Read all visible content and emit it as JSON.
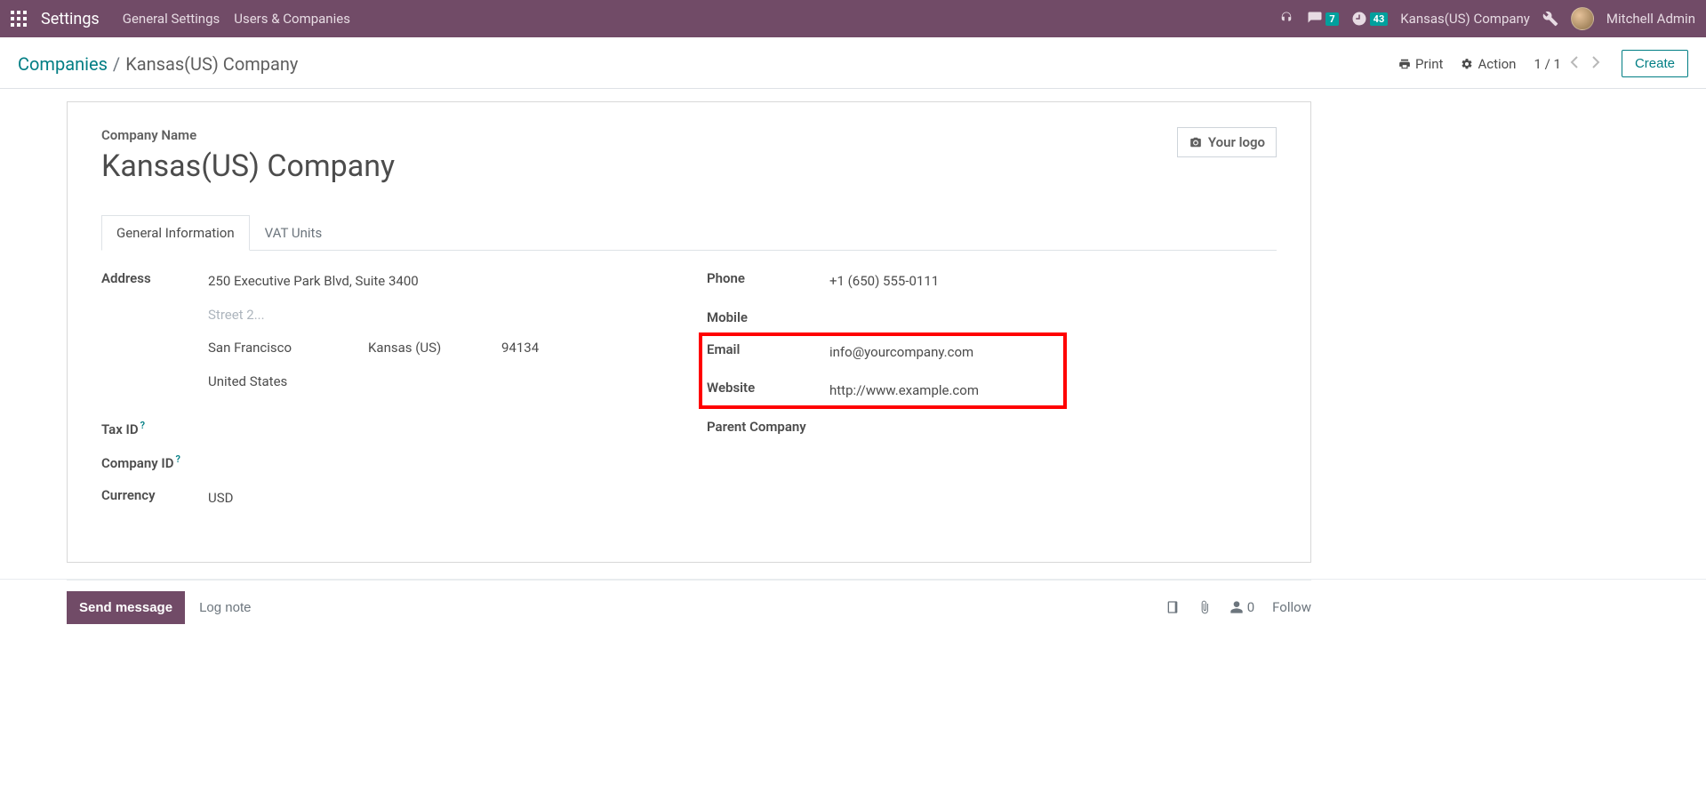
{
  "navbar": {
    "brand": "Settings",
    "links": [
      "General Settings",
      "Users & Companies"
    ],
    "messages_badge": "7",
    "activities_badge": "43",
    "company": "Kansas(US) Company",
    "user": "Mitchell Admin"
  },
  "breadcrumb": {
    "root": "Companies",
    "current": "Kansas(US) Company"
  },
  "actions": {
    "print": "Print",
    "action": "Action",
    "create": "Create"
  },
  "pager": {
    "text": "1 / 1"
  },
  "form": {
    "name_label": "Company Name",
    "name_value": "Kansas(US) Company",
    "logo_label": "Your logo",
    "tabs": [
      "General Information",
      "VAT Units"
    ],
    "left": {
      "address_label": "Address",
      "street1": "250 Executive Park Blvd, Suite 3400",
      "street2_placeholder": "Street 2...",
      "city": "San Francisco",
      "state": "Kansas (US)",
      "zip": "94134",
      "country": "United States",
      "tax_id_label": "Tax ID",
      "company_id_label": "Company ID",
      "currency_label": "Currency",
      "currency_value": "USD"
    },
    "right": {
      "phone_label": "Phone",
      "phone_value": "+1 (650) 555-0111",
      "mobile_label": "Mobile",
      "email_label": "Email",
      "email_value": "info@yourcompany.com",
      "website_label": "Website",
      "website_value": "http://www.example.com",
      "parent_label": "Parent Company"
    }
  },
  "chatter": {
    "send": "Send message",
    "log": "Log note",
    "followers_count": "0",
    "follow": "Follow"
  }
}
